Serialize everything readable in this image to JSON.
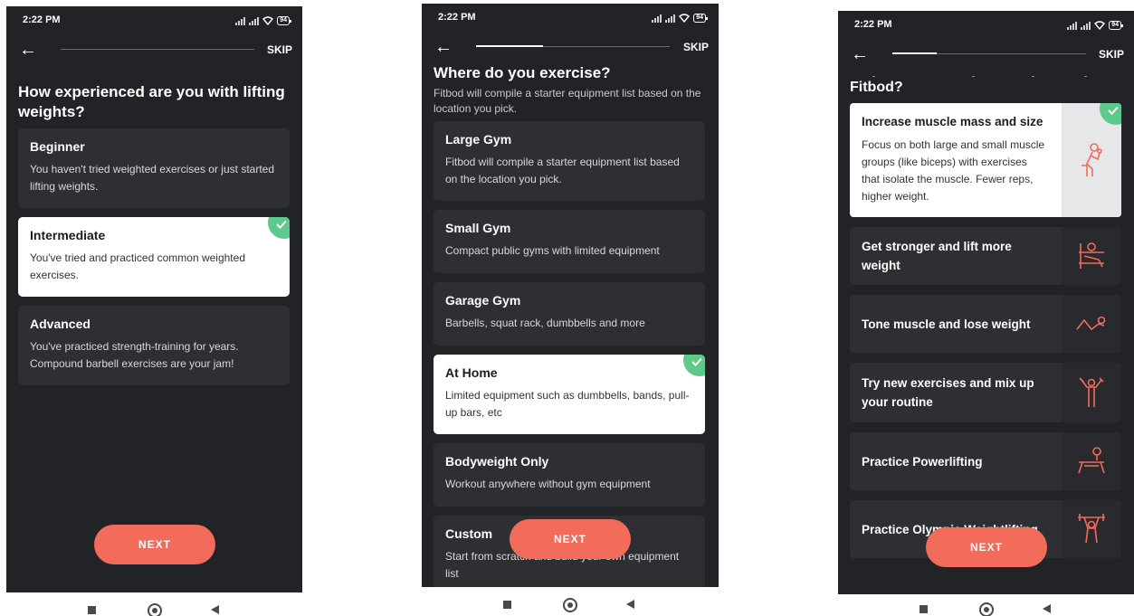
{
  "colors": {
    "background": "#222327",
    "card": "#2e2f33",
    "selected_card": "#ffffff",
    "accent": "#f26b5b",
    "check": "#5dc98a"
  },
  "screens": [
    {
      "status": {
        "time": "2:22 PM",
        "battery": "94"
      },
      "skip_label": "SKIP",
      "progress": 0.0,
      "title": "How experienced are you with lifting weights?",
      "options": [
        {
          "title": "Beginner",
          "description": "You haven't tried weighted exercises or just started lifting weights.",
          "selected": false
        },
        {
          "title": "Intermediate",
          "description": "You've tried and practiced common weighted exercises.",
          "selected": true
        },
        {
          "title": "Advanced",
          "description": "You've practiced strength-training for years. Compound barbell exercises are your jam!",
          "selected": false
        }
      ],
      "next_label": "NEXT"
    },
    {
      "status": {
        "time": "2:22 PM",
        "battery": "94"
      },
      "skip_label": "SKIP",
      "progress": 0.3,
      "title": "Where do you exercise?",
      "subtitle": "Fitbod will compile a starter equipment list based on the location you pick.",
      "options": [
        {
          "title": "Large Gym",
          "description": "Fitbod will compile a starter equipment list based on the location you pick.",
          "selected": false
        },
        {
          "title": "Small Gym",
          "description": "Compact public gyms with limited equipment",
          "selected": false
        },
        {
          "title": "Garage Gym",
          "description": "Barbells, squat rack, dumbbells and more",
          "selected": false
        },
        {
          "title": "At Home",
          "description": "Limited equipment such as dumbbells, bands, pull-up bars, etc",
          "selected": true
        },
        {
          "title": "Bodyweight Only",
          "description": "Workout anywhere without gym equipment",
          "selected": false
        },
        {
          "title": "Custom",
          "description": "Start from scratch and build your own equipment list",
          "selected": false
        }
      ],
      "next_label": "NEXT"
    },
    {
      "status": {
        "time": "2:22 PM",
        "battery": "94"
      },
      "skip_label": "SKIP",
      "progress": 0.23,
      "title": "Fitbod?",
      "options": [
        {
          "title": "Increase muscle mass and size",
          "description": "Focus on both large and small muscle groups (like biceps) with exercises that isolate the muscle. Fewer reps, higher weight.",
          "selected": true,
          "icon": "bicep-curl-icon"
        },
        {
          "title": "Get stronger and lift more weight",
          "selected": false,
          "icon": "bench-press-icon"
        },
        {
          "title": "Tone muscle and lose weight",
          "selected": false,
          "icon": "floor-exercise-icon"
        },
        {
          "title": "Try new exercises and mix up your routine",
          "selected": false,
          "icon": "dumbbell-raise-icon"
        },
        {
          "title": "Practice Powerlifting",
          "selected": false,
          "icon": "powerlifting-bench-icon"
        },
        {
          "title": "Practice Olympic Weightlifting",
          "selected": false,
          "icon": "barbell-overhead-icon"
        }
      ],
      "next_label": "NEXT"
    }
  ]
}
